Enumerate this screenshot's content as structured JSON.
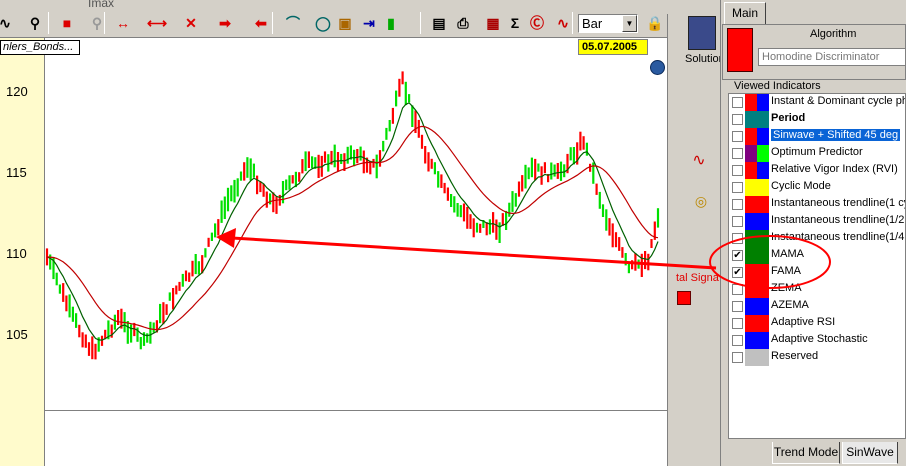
{
  "toolbar": {
    "menu_stub": "Imax",
    "period": "Bar",
    "icons": [
      "curve-icon",
      "zoom-icon",
      "color-icon",
      "zoom-gray-icon",
      "h-span-icon",
      "h-arrows-icon",
      "crossed-arrows-icon",
      "right-arrow-icon",
      "left-arrow-icon",
      "curve-tool-icon",
      "circle-tool-icon",
      "folder-tool-icon",
      "indent-tool-icon",
      "bar-green-icon",
      "page-icon",
      "print-icon",
      "chart-icon",
      "sigma-icon",
      "c-arrow-icon",
      "curve-red-icon",
      "lock-icon"
    ]
  },
  "chart": {
    "symbol": "nlers_Bonds...",
    "date": "05.07.2005",
    "y_ticks": [
      "120",
      "115",
      "110",
      "105"
    ]
  },
  "middle": {
    "solution_label": "Solution",
    "signal_label": "tal Signa"
  },
  "panel": {
    "tab_main": "Main",
    "algorithm_label": "Algorithm",
    "algorithm_value": "Homodine Discriminator",
    "viewed_label": "Viewed Indicators",
    "indicators": [
      {
        "label": "Instant & Dominant cycle pha",
        "c1": "#ff0000",
        "c2": "#0000ff",
        "checked": false,
        "style": ""
      },
      {
        "label": "Period",
        "c1": "#008080",
        "c2": "#008080",
        "checked": false,
        "style": "bold"
      },
      {
        "label": "Sinwave + Shifted 45 deg",
        "c1": "#ff0000",
        "c2": "#0000ff",
        "checked": false,
        "style": "sel"
      },
      {
        "label": "Optimum Predictor",
        "c1": "#800080",
        "c2": "#00ff00",
        "checked": false,
        "style": ""
      },
      {
        "label": "Relative Vigor Index (RVI)",
        "c1": "#ff0000",
        "c2": "#0000ff",
        "checked": false,
        "style": ""
      },
      {
        "label": "Cyclic Mode",
        "c1": "#ffff00",
        "c2": "#ffff00",
        "checked": false,
        "style": ""
      },
      {
        "label": "Instantaneous trendline(1 cyc",
        "c1": "#ff0000",
        "c2": "#ff0000",
        "checked": false,
        "style": ""
      },
      {
        "label": "Instantaneous trendline(1/2 c",
        "c1": "#0000ff",
        "c2": "#0000ff",
        "checked": false,
        "style": ""
      },
      {
        "label": "Instantaneous trendline(1/4 c",
        "c1": "#008000",
        "c2": "#008000",
        "checked": false,
        "style": ""
      },
      {
        "label": "MAMA",
        "c1": "#008000",
        "c2": "#008000",
        "checked": true,
        "style": ""
      },
      {
        "label": "FAMA",
        "c1": "#ff0000",
        "c2": "#ff0000",
        "checked": true,
        "style": ""
      },
      {
        "label": "ZEMA",
        "c1": "#ff0000",
        "c2": "#ff0000",
        "checked": false,
        "style": ""
      },
      {
        "label": "AZEMA",
        "c1": "#0000ff",
        "c2": "#0000ff",
        "checked": false,
        "style": ""
      },
      {
        "label": "Adaptive RSI",
        "c1": "#ff0000",
        "c2": "#ff0000",
        "checked": false,
        "style": ""
      },
      {
        "label": "Adaptive Stochastic",
        "c1": "#0000ff",
        "c2": "#0000ff",
        "checked": false,
        "style": ""
      },
      {
        "label": "Reserved",
        "c1": "#c0c0c0",
        "c2": "#c0c0c0",
        "checked": false,
        "style": ""
      }
    ],
    "bottom_tabs": [
      "Trend Mode",
      "SinWave"
    ]
  },
  "colors": {
    "bar_up": "#00e000",
    "bar_down": "#ff0000",
    "mama": "#006000",
    "fama": "#c00000",
    "arrow": "#ff0000"
  }
}
